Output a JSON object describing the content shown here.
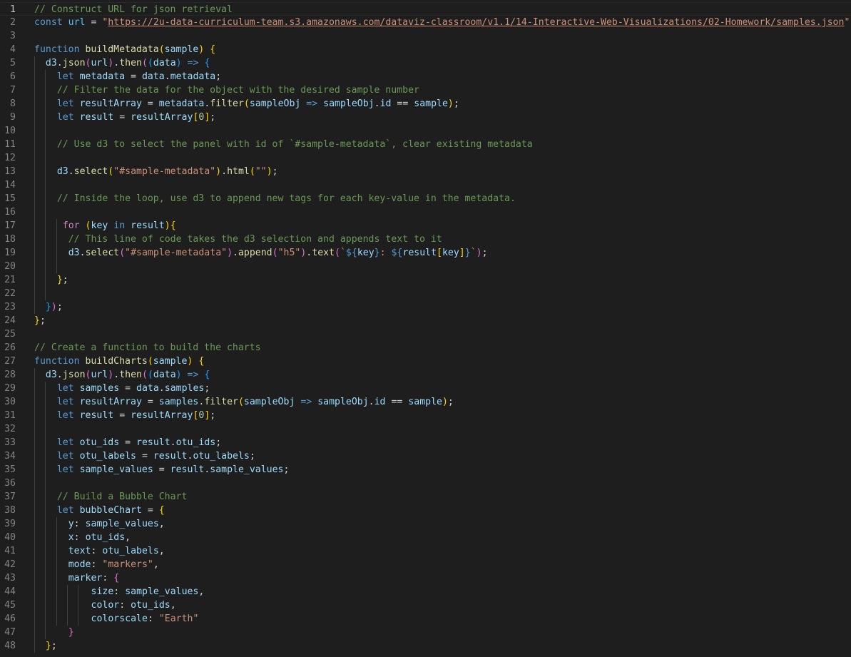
{
  "editor": {
    "language": "javascript",
    "active_line": 1,
    "lines": [
      "// Construct URL for json retrieval",
      "const url = \"https://2u-data-curriculum-team.s3.amazonaws.com/dataviz-classroom/v1.1/14-Interactive-Web-Visualizations/02-Homework/samples.json\";",
      "",
      "function buildMetadata(sample) {",
      "  d3.json(url).then((data) => {",
      "    let metadata = data.metadata;",
      "    // Filter the data for the object with the desired sample number",
      "    let resultArray = metadata.filter(sampleObj => sampleObj.id == sample);",
      "    let result = resultArray[0];",
      "",
      "    // Use d3 to select the panel with id of `#sample-metadata`, clear existing metadata",
      "",
      "    d3.select(\"#sample-metadata\").html(\"\");",
      "",
      "    // Inside the loop, use d3 to append new tags for each key-value in the metadata.",
      "",
      "     for (key in result){",
      "      // This line of code takes the d3 selection and appends text to it",
      "      d3.select(\"#sample-metadata\").append(\"h5\").text(`${key}: ${result[key]}`);",
      "",
      "    };",
      "",
      "  });",
      "};",
      "",
      "// Create a function to build the charts",
      "function buildCharts(sample) {",
      "  d3.json(url).then((data) => {",
      "    let samples = data.samples;",
      "    let resultArray = samples.filter(sampleObj => sampleObj.id == sample);",
      "    let result = resultArray[0];",
      "",
      "    let otu_ids = result.otu_ids;",
      "    let otu_labels = result.otu_labels;",
      "    let sample_values = result.sample_values;",
      "",
      "    // Build a Bubble Chart",
      "    let bubbleChart = {",
      "      y: sample_values,",
      "      x: otu_ids,",
      "      text: otu_labels,",
      "      mode: \"markers\",",
      "      marker: {",
      "          size: sample_values,",
      "          color: otu_ids,",
      "          colorscale: \"Earth\"",
      "      }",
      "  };"
    ]
  }
}
